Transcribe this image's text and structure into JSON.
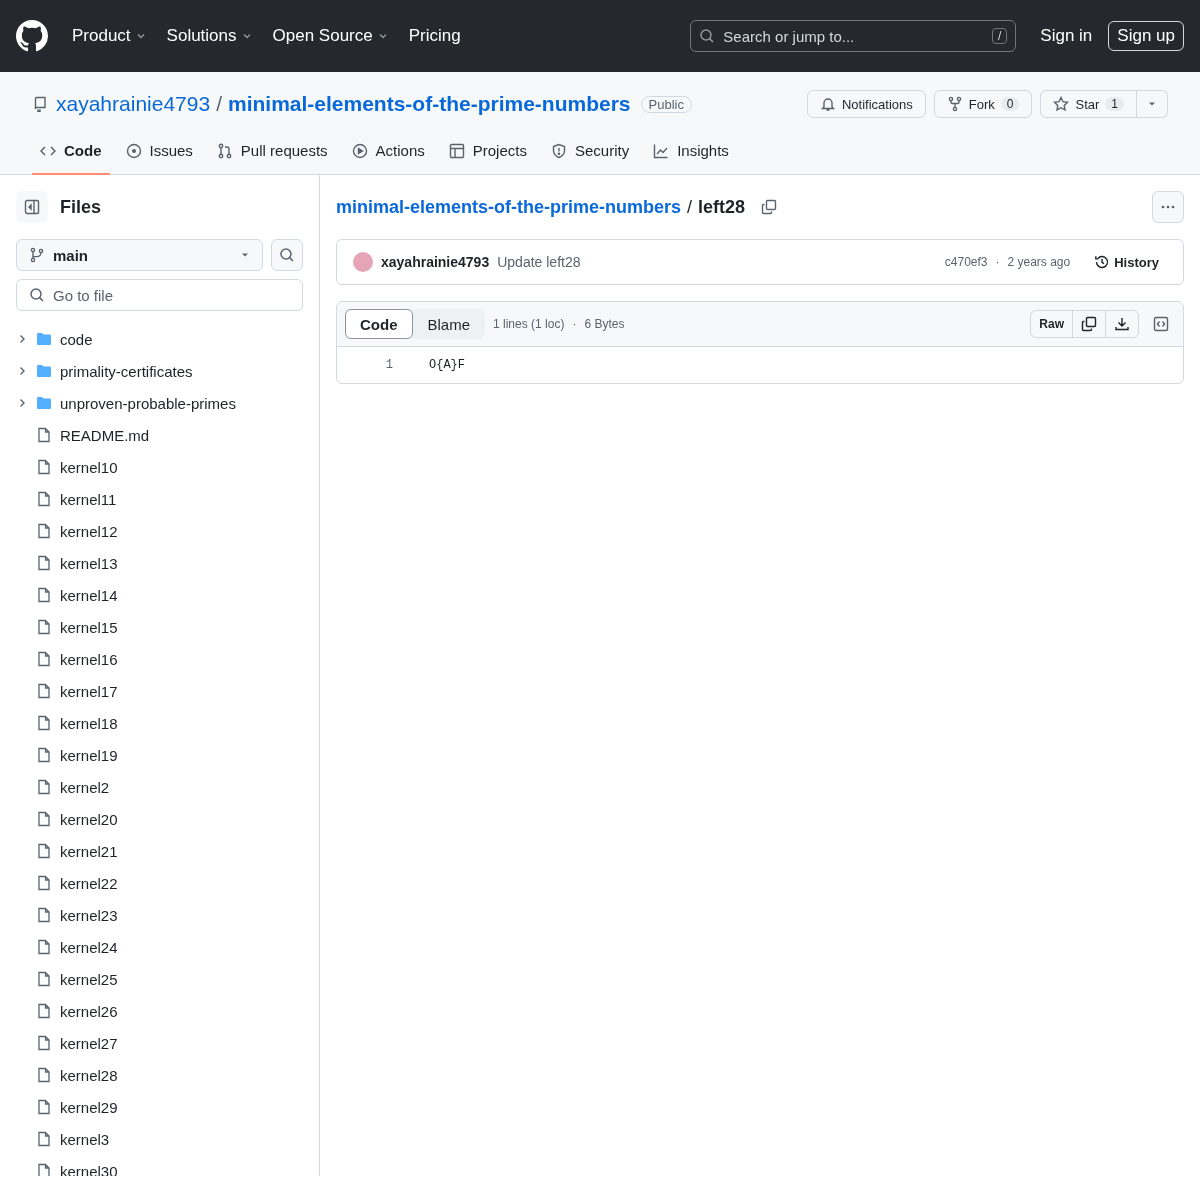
{
  "top_nav": {
    "items": [
      {
        "label": "Product",
        "has_menu": true
      },
      {
        "label": "Solutions",
        "has_menu": true
      },
      {
        "label": "Open Source",
        "has_menu": true
      },
      {
        "label": "Pricing",
        "has_menu": false
      }
    ],
    "search": {
      "placeholder": "Search or jump to...",
      "shortcut": "/"
    },
    "sign_in": "Sign in",
    "sign_up": "Sign up"
  },
  "repo": {
    "owner": "xayahrainie4793",
    "separator": "/",
    "name": "minimal-elements-of-the-prime-numbers",
    "visibility": "Public",
    "notifications": "Notifications",
    "fork": {
      "label": "Fork",
      "count": "0"
    },
    "star": {
      "label": "Star",
      "count": "1"
    }
  },
  "tabs": [
    {
      "label": "Code",
      "kind": "code",
      "selected": true
    },
    {
      "label": "Issues",
      "kind": "issues",
      "selected": false
    },
    {
      "label": "Pull requests",
      "kind": "pulls",
      "selected": false
    },
    {
      "label": "Actions",
      "kind": "actions",
      "selected": false
    },
    {
      "label": "Projects",
      "kind": "projects",
      "selected": false
    },
    {
      "label": "Security",
      "kind": "security",
      "selected": false
    },
    {
      "label": "Insights",
      "kind": "insights",
      "selected": false
    }
  ],
  "sidebar": {
    "title": "Files",
    "branch": "main",
    "filter_placeholder": "Go to file",
    "items": [
      {
        "name": "code",
        "kind": "folder",
        "expanded": false
      },
      {
        "name": "primality-certificates",
        "kind": "folder",
        "expanded": false
      },
      {
        "name": "unproven-probable-primes",
        "kind": "folder",
        "expanded": false
      },
      {
        "name": "README.md",
        "kind": "file"
      },
      {
        "name": "kernel10",
        "kind": "file"
      },
      {
        "name": "kernel11",
        "kind": "file"
      },
      {
        "name": "kernel12",
        "kind": "file"
      },
      {
        "name": "kernel13",
        "kind": "file"
      },
      {
        "name": "kernel14",
        "kind": "file"
      },
      {
        "name": "kernel15",
        "kind": "file"
      },
      {
        "name": "kernel16",
        "kind": "file"
      },
      {
        "name": "kernel17",
        "kind": "file"
      },
      {
        "name": "kernel18",
        "kind": "file"
      },
      {
        "name": "kernel19",
        "kind": "file"
      },
      {
        "name": "kernel2",
        "kind": "file"
      },
      {
        "name": "kernel20",
        "kind": "file"
      },
      {
        "name": "kernel21",
        "kind": "file"
      },
      {
        "name": "kernel22",
        "kind": "file"
      },
      {
        "name": "kernel23",
        "kind": "file"
      },
      {
        "name": "kernel24",
        "kind": "file"
      },
      {
        "name": "kernel25",
        "kind": "file"
      },
      {
        "name": "kernel26",
        "kind": "file"
      },
      {
        "name": "kernel27",
        "kind": "file"
      },
      {
        "name": "kernel28",
        "kind": "file"
      },
      {
        "name": "kernel29",
        "kind": "file"
      },
      {
        "name": "kernel3",
        "kind": "file"
      },
      {
        "name": "kernel30",
        "kind": "file"
      }
    ]
  },
  "breadcrumb": {
    "repo": "minimal-elements-of-the-prime-numbers",
    "separator": "/",
    "file": "left28"
  },
  "commit": {
    "author": "xayahrainie4793",
    "message": "Update left28",
    "sha": "c470ef3",
    "separator": "·",
    "age": "2 years ago",
    "history": "History"
  },
  "file_view": {
    "modes": [
      {
        "label": "Code",
        "selected": true
      },
      {
        "label": "Blame",
        "selected": false
      }
    ],
    "lines_info": "1 lines (1 loc)",
    "separator": "·",
    "size": "6 Bytes",
    "raw": "Raw",
    "lines": [
      {
        "number": "1",
        "text": "O{A}F"
      }
    ]
  }
}
